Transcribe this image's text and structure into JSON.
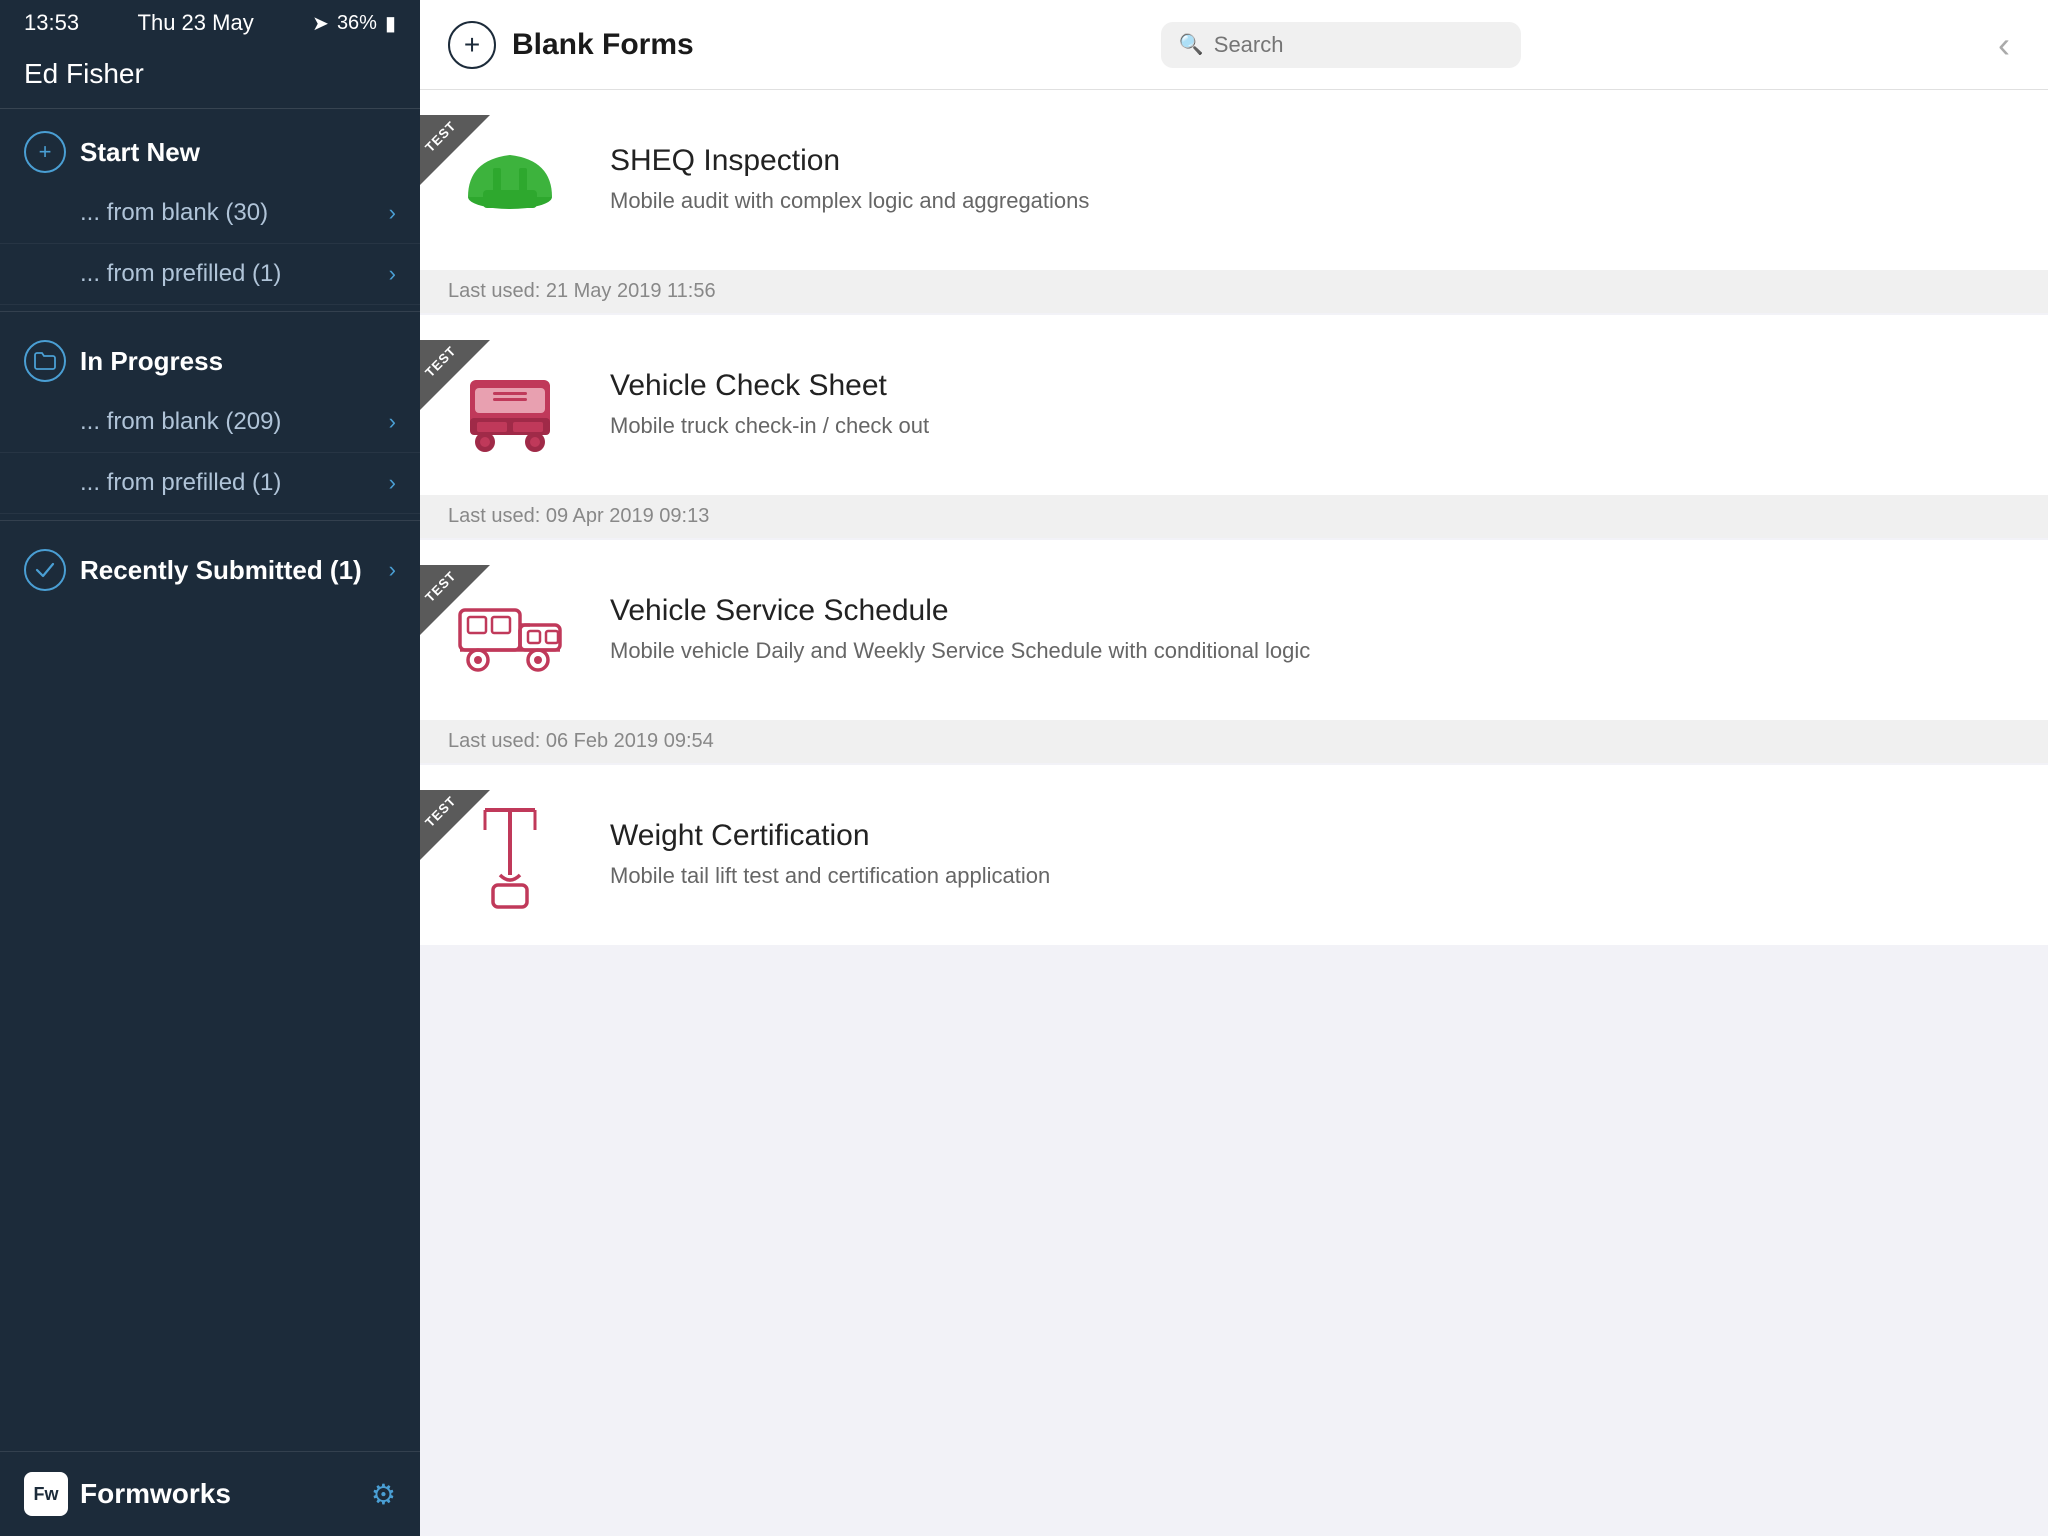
{
  "statusBar": {
    "time": "13:53",
    "date": "Thu 23 May",
    "battery": "36%",
    "batterySymbol": "🔋"
  },
  "sidebar": {
    "userName": "Ed Fisher",
    "sections": [
      {
        "id": "start-new",
        "icon": "+",
        "title": "Start New",
        "items": [
          {
            "label": "... from blank (30)",
            "arrow": "›"
          },
          {
            "label": "... from prefilled (1)",
            "arrow": "›"
          }
        ]
      },
      {
        "id": "in-progress",
        "icon": "📁",
        "iconType": "folder",
        "title": "In Progress",
        "items": [
          {
            "label": "... from blank (209)",
            "arrow": "›"
          },
          {
            "label": "... from prefilled (1)",
            "arrow": "›"
          }
        ]
      }
    ],
    "recentlySubmitted": {
      "label": "Recently Submitted (1)",
      "arrow": "›"
    },
    "brand": {
      "initials": "Fw",
      "name": "Formworks"
    },
    "gearIcon": "⚙"
  },
  "mainHeader": {
    "addIcon": "+",
    "title": "Blank Forms",
    "searchPlaceholder": "Search",
    "backIcon": "‹"
  },
  "forms": [
    {
      "id": "sheq",
      "badge": "TEST",
      "title": "SHEQ Inspection",
      "subtitle": "Mobile audit with complex logic and aggregations",
      "iconType": "hard-hat",
      "iconColor": "#3db33d",
      "lastUsed": "Last used: 21 May 2019 11:56"
    },
    {
      "id": "vehicle-check",
      "badge": "TEST",
      "title": "Vehicle Check Sheet",
      "subtitle": "Mobile truck check-in / check out",
      "iconType": "truck-front",
      "iconColor": "#c0395a",
      "lastUsed": "Last used: 09 Apr 2019 09:13"
    },
    {
      "id": "vehicle-service",
      "badge": "TEST",
      "title": "Vehicle Service Schedule",
      "subtitle": "Mobile vehicle Daily and Weekly Service Schedule with conditional logic",
      "iconType": "truck-side",
      "iconColor": "#c0395a",
      "lastUsed": "Last used: 06 Feb 2019 09:54"
    },
    {
      "id": "weight-cert",
      "badge": "TEST",
      "title": "Weight Certification",
      "subtitle": "Mobile tail lift test and certification application",
      "iconType": "crane",
      "iconColor": "#c0395a",
      "lastUsed": ""
    }
  ]
}
